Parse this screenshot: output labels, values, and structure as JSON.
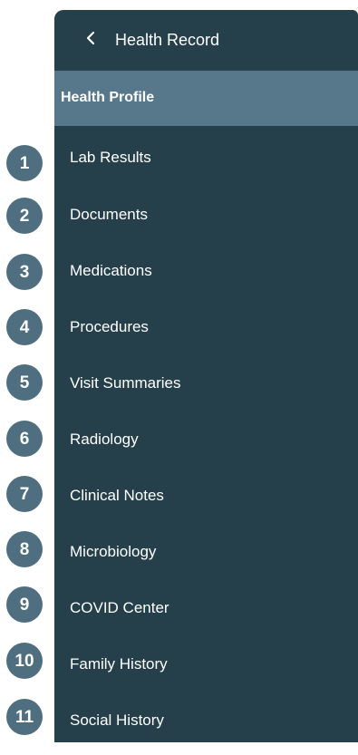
{
  "header": {
    "back_icon": "chevron-left-icon",
    "title": "Health Record"
  },
  "section": {
    "title": "Health Profile"
  },
  "nav_items": [
    {
      "label": "Lab Results"
    },
    {
      "label": "Documents"
    },
    {
      "label": "Medications"
    },
    {
      "label": "Procedures"
    },
    {
      "label": "Visit Summaries"
    },
    {
      "label": "Radiology"
    },
    {
      "label": "Clinical Notes"
    },
    {
      "label": "Microbiology"
    },
    {
      "label": "COVID Center"
    },
    {
      "label": "Family History"
    },
    {
      "label": "Social History"
    }
  ],
  "markers": [
    "1",
    "2",
    "3",
    "4",
    "5",
    "6",
    "7",
    "8",
    "9",
    "10",
    "11"
  ],
  "colors": {
    "sidebar_bg": "#25404b",
    "section_bg": "#56788a",
    "marker_bg": "#4f6f80",
    "text": "#ffffff"
  }
}
